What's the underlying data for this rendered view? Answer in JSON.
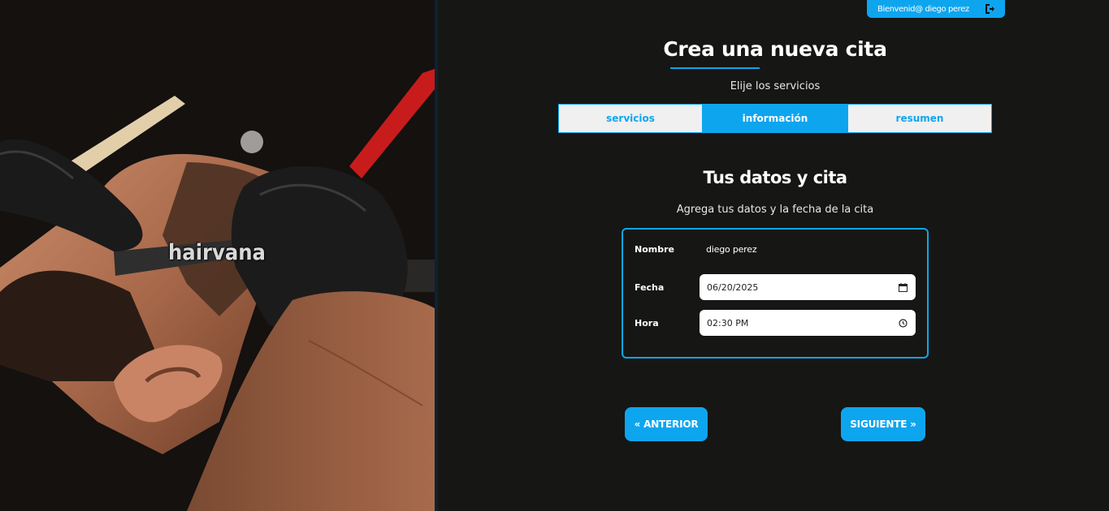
{
  "brand": {
    "logo_text": "hairvana",
    "accent": "#0ea5ef"
  },
  "header": {
    "welcome": "Bienvenid@ diego perez",
    "logout_icon": "logout-icon"
  },
  "page": {
    "title": "Crea una nueva cita",
    "subtitle": "Elije los servicios"
  },
  "tabs": [
    {
      "label": "servicios",
      "active": false
    },
    {
      "label": "información",
      "active": true
    },
    {
      "label": "resumen",
      "active": false
    }
  ],
  "section": {
    "title": "Tus datos y cita",
    "description": "Agrega tus datos y la fecha de la cita"
  },
  "form": {
    "name_label": "Nombre",
    "name_value": "diego perez",
    "date_label": "Fecha",
    "date_value": "06/20/2025",
    "time_label": "Hora",
    "time_value": "02:30 PM"
  },
  "nav": {
    "prev_label": "« ANTERIOR",
    "next_label": "SIGUIENTE »"
  }
}
